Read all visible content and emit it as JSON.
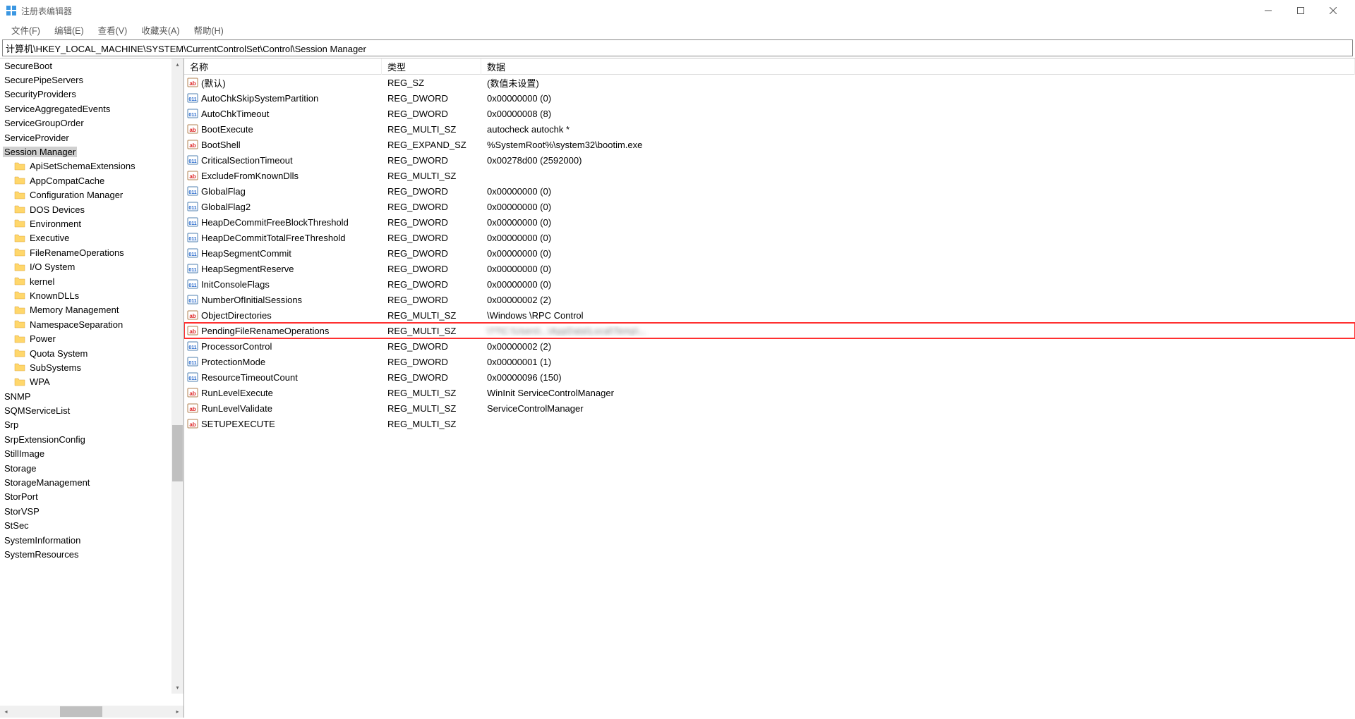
{
  "window": {
    "title": "注册表编辑器"
  },
  "menu": {
    "file": "文件(F)",
    "edit": "编辑(E)",
    "view": "查看(V)",
    "favorites": "收藏夹(A)",
    "help": "帮助(H)"
  },
  "address": "计算机\\HKEY_LOCAL_MACHINE\\SYSTEM\\CurrentControlSet\\Control\\Session Manager",
  "columns": {
    "name": "名称",
    "type": "类型",
    "data": "数据"
  },
  "tree": [
    {
      "label": "SecureBoot",
      "level": 0,
      "folder": false
    },
    {
      "label": "SecurePipeServers",
      "level": 0,
      "folder": false
    },
    {
      "label": "SecurityProviders",
      "level": 0,
      "folder": false
    },
    {
      "label": "ServiceAggregatedEvents",
      "level": 0,
      "folder": false
    },
    {
      "label": "ServiceGroupOrder",
      "level": 0,
      "folder": false
    },
    {
      "label": "ServiceProvider",
      "level": 0,
      "folder": false
    },
    {
      "label": "Session Manager",
      "level": 0,
      "folder": false,
      "selected": true
    },
    {
      "label": "ApiSetSchemaExtensions",
      "level": 1,
      "folder": true
    },
    {
      "label": "AppCompatCache",
      "level": 1,
      "folder": true
    },
    {
      "label": "Configuration Manager",
      "level": 1,
      "folder": true
    },
    {
      "label": "DOS Devices",
      "level": 1,
      "folder": true
    },
    {
      "label": "Environment",
      "level": 1,
      "folder": true
    },
    {
      "label": "Executive",
      "level": 1,
      "folder": true
    },
    {
      "label": "FileRenameOperations",
      "level": 1,
      "folder": true
    },
    {
      "label": "I/O System",
      "level": 1,
      "folder": true
    },
    {
      "label": "kernel",
      "level": 1,
      "folder": true
    },
    {
      "label": "KnownDLLs",
      "level": 1,
      "folder": true
    },
    {
      "label": "Memory Management",
      "level": 1,
      "folder": true
    },
    {
      "label": "NamespaceSeparation",
      "level": 1,
      "folder": true
    },
    {
      "label": "Power",
      "level": 1,
      "folder": true
    },
    {
      "label": "Quota System",
      "level": 1,
      "folder": true
    },
    {
      "label": "SubSystems",
      "level": 1,
      "folder": true
    },
    {
      "label": "WPA",
      "level": 1,
      "folder": true
    },
    {
      "label": "SNMP",
      "level": 0,
      "folder": false
    },
    {
      "label": "SQMServiceList",
      "level": 0,
      "folder": false
    },
    {
      "label": "Srp",
      "level": 0,
      "folder": false
    },
    {
      "label": "SrpExtensionConfig",
      "level": 0,
      "folder": false
    },
    {
      "label": "StillImage",
      "level": 0,
      "folder": false
    },
    {
      "label": "Storage",
      "level": 0,
      "folder": false
    },
    {
      "label": "StorageManagement",
      "level": 0,
      "folder": false
    },
    {
      "label": "StorPort",
      "level": 0,
      "folder": false
    },
    {
      "label": "StorVSP",
      "level": 0,
      "folder": false
    },
    {
      "label": "StSec",
      "level": 0,
      "folder": false
    },
    {
      "label": "SystemInformation",
      "level": 0,
      "folder": false
    },
    {
      "label": "SystemResources",
      "level": 0,
      "folder": false
    }
  ],
  "values": [
    {
      "icon": "sz",
      "name": "(默认)",
      "type": "REG_SZ",
      "data": "(数值未设置)"
    },
    {
      "icon": "dw",
      "name": "AutoChkSkipSystemPartition",
      "type": "REG_DWORD",
      "data": "0x00000000 (0)"
    },
    {
      "icon": "dw",
      "name": "AutoChkTimeout",
      "type": "REG_DWORD",
      "data": "0x00000008 (8)"
    },
    {
      "icon": "sz",
      "name": "BootExecute",
      "type": "REG_MULTI_SZ",
      "data": "autocheck autochk *"
    },
    {
      "icon": "sz",
      "name": "BootShell",
      "type": "REG_EXPAND_SZ",
      "data": "%SystemRoot%\\system32\\bootim.exe"
    },
    {
      "icon": "dw",
      "name": "CriticalSectionTimeout",
      "type": "REG_DWORD",
      "data": "0x00278d00 (2592000)"
    },
    {
      "icon": "sz",
      "name": "ExcludeFromKnownDlls",
      "type": "REG_MULTI_SZ",
      "data": ""
    },
    {
      "icon": "dw",
      "name": "GlobalFlag",
      "type": "REG_DWORD",
      "data": "0x00000000 (0)"
    },
    {
      "icon": "dw",
      "name": "GlobalFlag2",
      "type": "REG_DWORD",
      "data": "0x00000000 (0)"
    },
    {
      "icon": "dw",
      "name": "HeapDeCommitFreeBlockThreshold",
      "type": "REG_DWORD",
      "data": "0x00000000 (0)"
    },
    {
      "icon": "dw",
      "name": "HeapDeCommitTotalFreeThreshold",
      "type": "REG_DWORD",
      "data": "0x00000000 (0)"
    },
    {
      "icon": "dw",
      "name": "HeapSegmentCommit",
      "type": "REG_DWORD",
      "data": "0x00000000 (0)"
    },
    {
      "icon": "dw",
      "name": "HeapSegmentReserve",
      "type": "REG_DWORD",
      "data": "0x00000000 (0)"
    },
    {
      "icon": "dw",
      "name": "InitConsoleFlags",
      "type": "REG_DWORD",
      "data": "0x00000000 (0)"
    },
    {
      "icon": "dw",
      "name": "NumberOfInitialSessions",
      "type": "REG_DWORD",
      "data": "0x00000002 (2)"
    },
    {
      "icon": "sz",
      "name": "ObjectDirectories",
      "type": "REG_MULTI_SZ",
      "data": "\\Windows \\RPC Control"
    },
    {
      "icon": "sz",
      "name": "PendingFileRenameOperations",
      "type": "REG_MULTI_SZ",
      "data": "\\??\\C:\\Users\\...\\AppData\\Local\\Temp\\...",
      "highlighted": true
    },
    {
      "icon": "dw",
      "name": "ProcessorControl",
      "type": "REG_DWORD",
      "data": "0x00000002 (2)"
    },
    {
      "icon": "dw",
      "name": "ProtectionMode",
      "type": "REG_DWORD",
      "data": "0x00000001 (1)"
    },
    {
      "icon": "dw",
      "name": "ResourceTimeoutCount",
      "type": "REG_DWORD",
      "data": "0x00000096 (150)"
    },
    {
      "icon": "sz",
      "name": "RunLevelExecute",
      "type": "REG_MULTI_SZ",
      "data": "WinInit ServiceControlManager"
    },
    {
      "icon": "sz",
      "name": "RunLevelValidate",
      "type": "REG_MULTI_SZ",
      "data": "ServiceControlManager"
    },
    {
      "icon": "sz",
      "name": "SETUPEXECUTE",
      "type": "REG_MULTI_SZ",
      "data": ""
    }
  ]
}
